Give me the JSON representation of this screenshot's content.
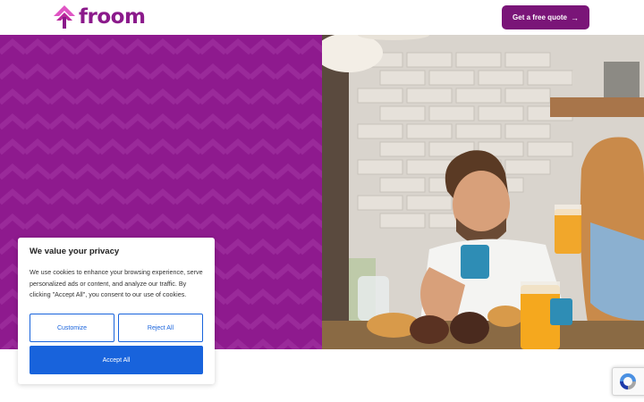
{
  "header": {
    "brand": "froom",
    "cta_label": "Get a free quote",
    "cta_icon": "arrow-right-icon"
  },
  "hero": {
    "pattern": "chevron-pattern",
    "photo": "couple-breakfast-photo"
  },
  "cookie_banner": {
    "title": "We value your privacy",
    "body": "We use cookies to enhance your browsing experience, serve personalized ads or content, and analyze our traffic. By clicking \"Accept All\", you consent to our use of cookies.",
    "customize_label": "Customize",
    "reject_label": "Reject All",
    "accept_label": "Accept All"
  },
  "recaptcha": {
    "icon": "recaptcha-icon"
  },
  "colors": {
    "brand_purple": "#8b1a8b",
    "cta_purple": "#7a1578",
    "hero_purple": "#8e1a8e",
    "consent_blue": "#1863dc"
  }
}
